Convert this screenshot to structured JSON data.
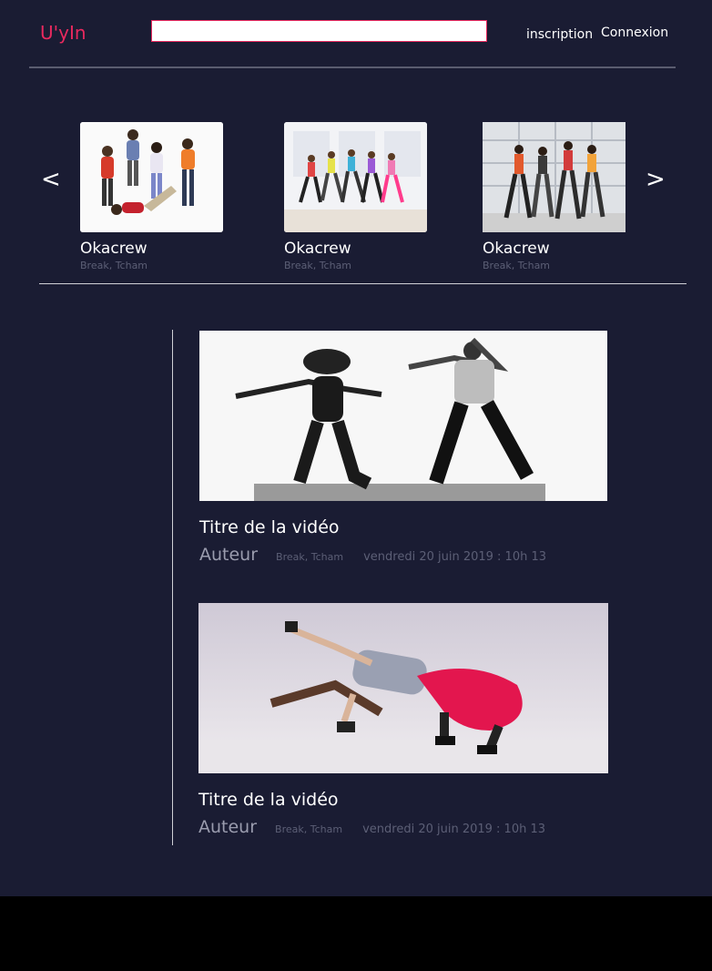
{
  "header": {
    "logo": "U'yIn",
    "search": {
      "value": "",
      "placeholder": ""
    },
    "signup_label": "inscription",
    "login_label": "Connexion"
  },
  "carousel": {
    "prev_label": "<",
    "next_label": ">",
    "items": [
      {
        "title": "Okacrew",
        "tags": "Break, Tcham"
      },
      {
        "title": "Okacrew",
        "tags": "Break, Tcham"
      },
      {
        "title": "Okacrew",
        "tags": "Break, Tcham"
      }
    ]
  },
  "videos": [
    {
      "title": "Titre de la vidéo",
      "author": "Auteur",
      "tags": "Break, Tcham",
      "date": "vendredi 20 juin 2019 : 10h 13"
    },
    {
      "title": "Titre de la vidéo",
      "author": "Auteur",
      "tags": "Break, Tcham",
      "date": "vendredi 20 juin 2019 : 10h 13"
    }
  ],
  "colors": {
    "background": "#1a1c33",
    "accent": "#e8295e",
    "text": "#ffffff",
    "muted": "#5c5f76",
    "divider": "#cfd0d6"
  }
}
